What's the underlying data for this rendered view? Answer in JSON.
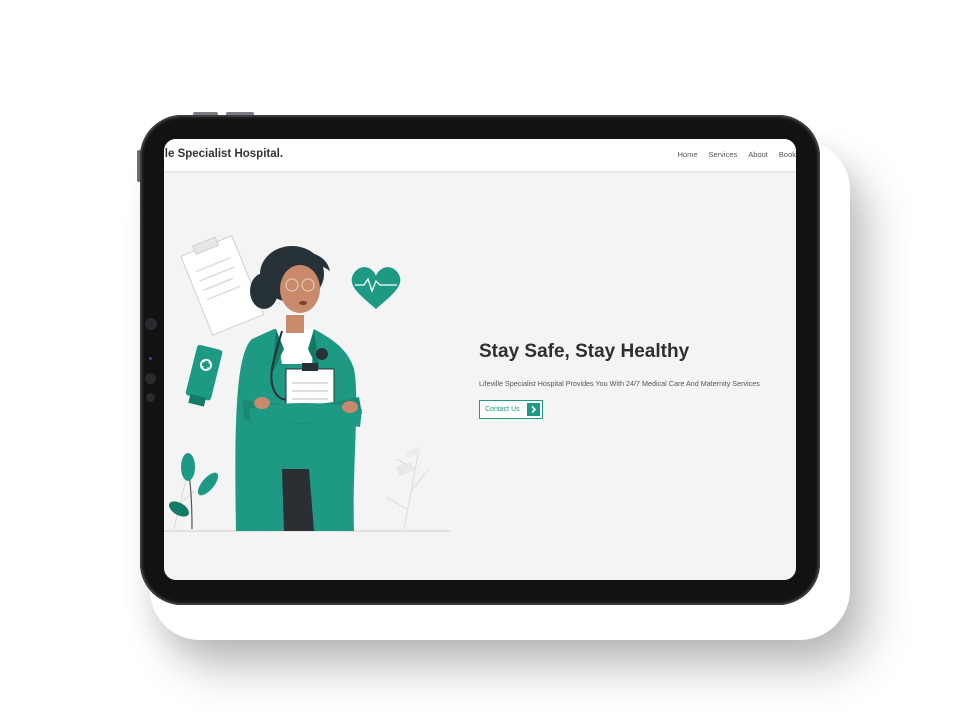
{
  "brand": {
    "name": "ville Specialist Hospital."
  },
  "nav": {
    "items": [
      "Home",
      "Services",
      "About",
      "Book"
    ]
  },
  "hero": {
    "title": "Stay Safe, Stay Healthy",
    "subtitle": "Lifeville Specialist Hospital Provides You With 24/7 Medical Care And Maternity Services",
    "cta_label": "Contact Us",
    "cta_icon": "chevron-right-icon"
  },
  "colors": {
    "accent": "#1e9a84",
    "page_background": "#f4f4f4",
    "device_frame": "#121212"
  }
}
